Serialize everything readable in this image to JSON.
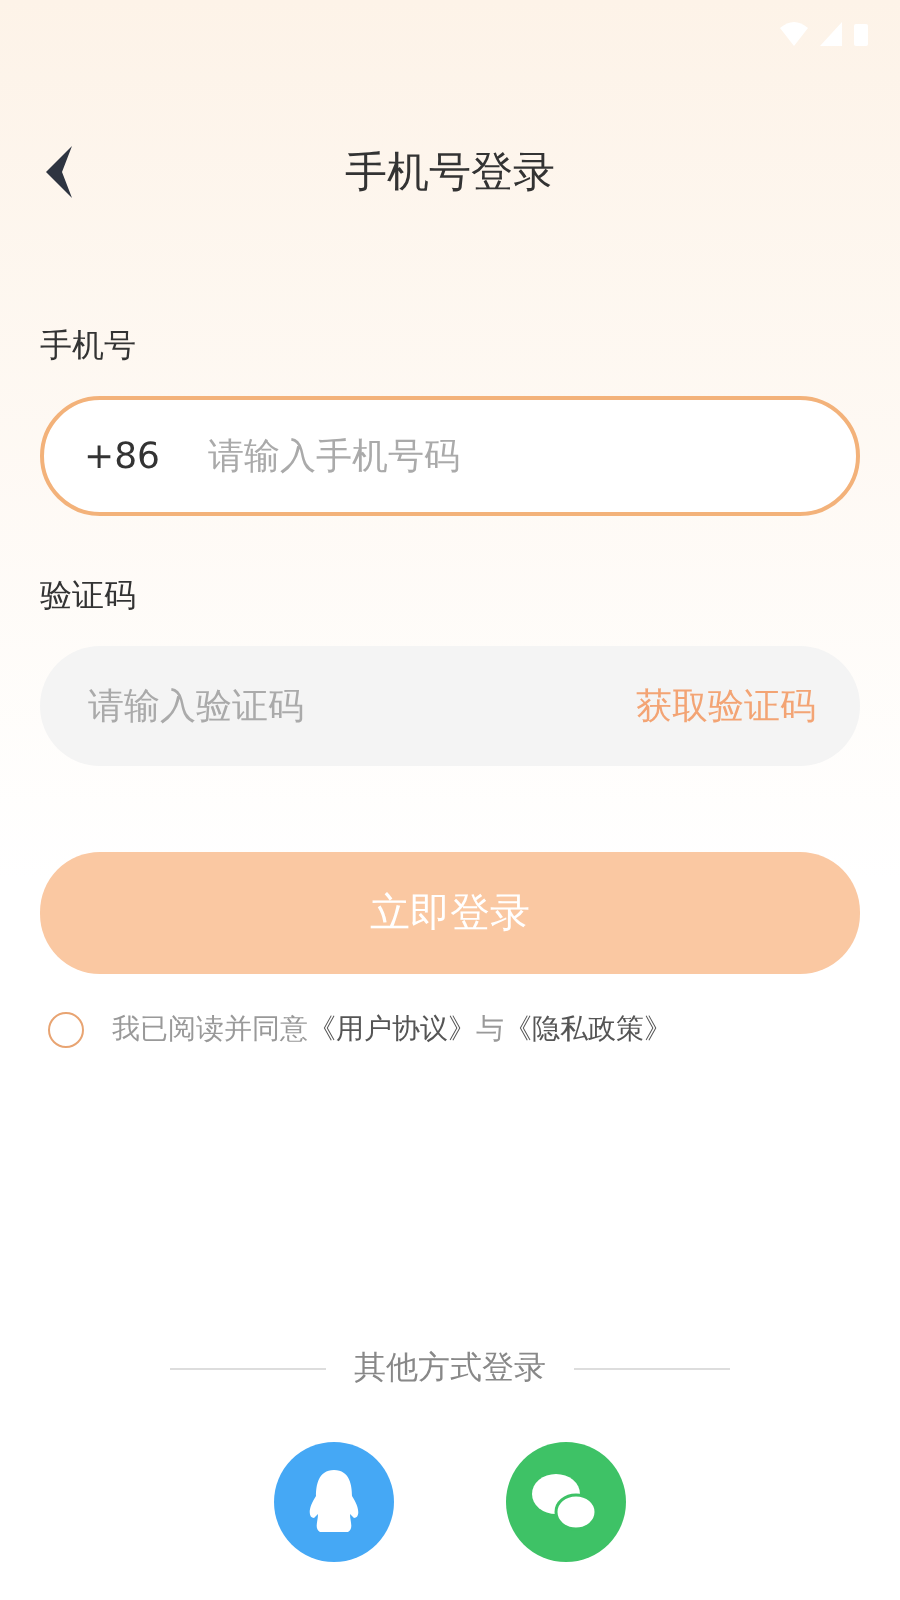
{
  "header": {
    "title": "手机号登录"
  },
  "phone": {
    "label": "手机号",
    "prefix": "+86",
    "placeholder": "请输入手机号码"
  },
  "code": {
    "label": "验证码",
    "placeholder": "请输入验证码",
    "action": "获取验证码"
  },
  "login_button": {
    "label": "立即登录",
    "disabled": true
  },
  "agreement": {
    "checked": false,
    "parts": [
      {
        "kind": "text",
        "text": "我已阅读并同意"
      },
      {
        "kind": "link",
        "text": "《用户协议》"
      },
      {
        "kind": "text",
        "text": "与"
      },
      {
        "kind": "link",
        "text": "《隐私政策》"
      }
    ]
  },
  "other_login": {
    "title": "其他方式登录",
    "methods": [
      {
        "kind": "qq"
      },
      {
        "kind": "wechat"
      }
    ]
  }
}
